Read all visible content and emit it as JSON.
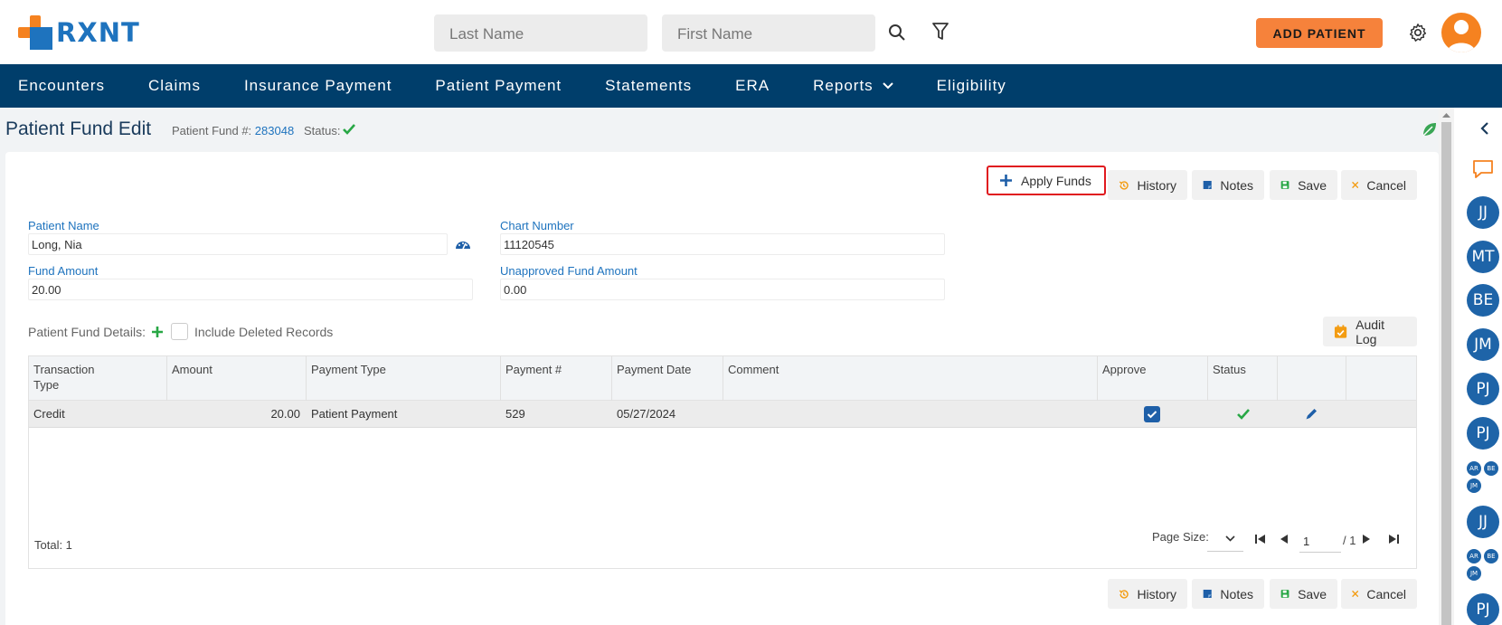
{
  "brand": {
    "name": "RXNT",
    "orange": "#f58220",
    "blue": "#1e73be",
    "navy": "#003e6b"
  },
  "header": {
    "last_name_placeholder": "Last Name",
    "first_name_placeholder": "First Name",
    "add_patient_label": "ADD PATIENT"
  },
  "nav": {
    "items": [
      {
        "label": "Encounters"
      },
      {
        "label": "Claims"
      },
      {
        "label": "Insurance Payment"
      },
      {
        "label": "Patient Payment"
      },
      {
        "label": "Statements"
      },
      {
        "label": "ERA"
      },
      {
        "label": "Reports"
      },
      {
        "label": "Eligibility"
      }
    ]
  },
  "page": {
    "title": "Patient Fund Edit",
    "fund_label": "Patient Fund #:",
    "fund_number": "283048",
    "status_label": "Status:"
  },
  "toolbar": {
    "apply_funds": "Apply Funds",
    "history": "History",
    "notes": "Notes",
    "save": "Save",
    "cancel": "Cancel"
  },
  "form": {
    "patient_name_label": "Patient Name",
    "patient_name_value": "Long, Nia",
    "chart_number_label": "Chart Number",
    "chart_number_value": "11120545",
    "fund_amount_label": "Fund Amount",
    "fund_amount_value": "20.00",
    "unapproved_label": "Unapproved Fund Amount",
    "unapproved_value": "0.00"
  },
  "details": {
    "label": "Patient Fund Details:",
    "include_deleted": "Include Deleted Records",
    "audit_log": "Audit Log"
  },
  "grid": {
    "headers": {
      "transaction_type_1": "Transaction",
      "transaction_type_2": "Type",
      "amount": "Amount",
      "payment_type": "Payment Type",
      "payment_num": "Payment #",
      "payment_date": "Payment Date",
      "comment": "Comment",
      "approve": "Approve",
      "status": "Status"
    },
    "rows": [
      {
        "transaction_type": "Credit",
        "amount": "20.00",
        "payment_type": "Patient Payment",
        "payment_num": "529",
        "payment_date": "05/27/2024",
        "comment": ""
      }
    ],
    "total": "Total: 1",
    "page_size_label": "Page Size:",
    "page_number": "1",
    "page_total": "/ 1"
  },
  "sidebar": {
    "bubbles": [
      "JJ",
      "MT",
      "BE",
      "JM",
      "PJ",
      "PJ",
      "JJ",
      "PJ"
    ],
    "group_1": [
      "AR",
      "BE",
      "JM"
    ],
    "group_2": [
      "AR",
      "BE",
      "JM"
    ]
  }
}
